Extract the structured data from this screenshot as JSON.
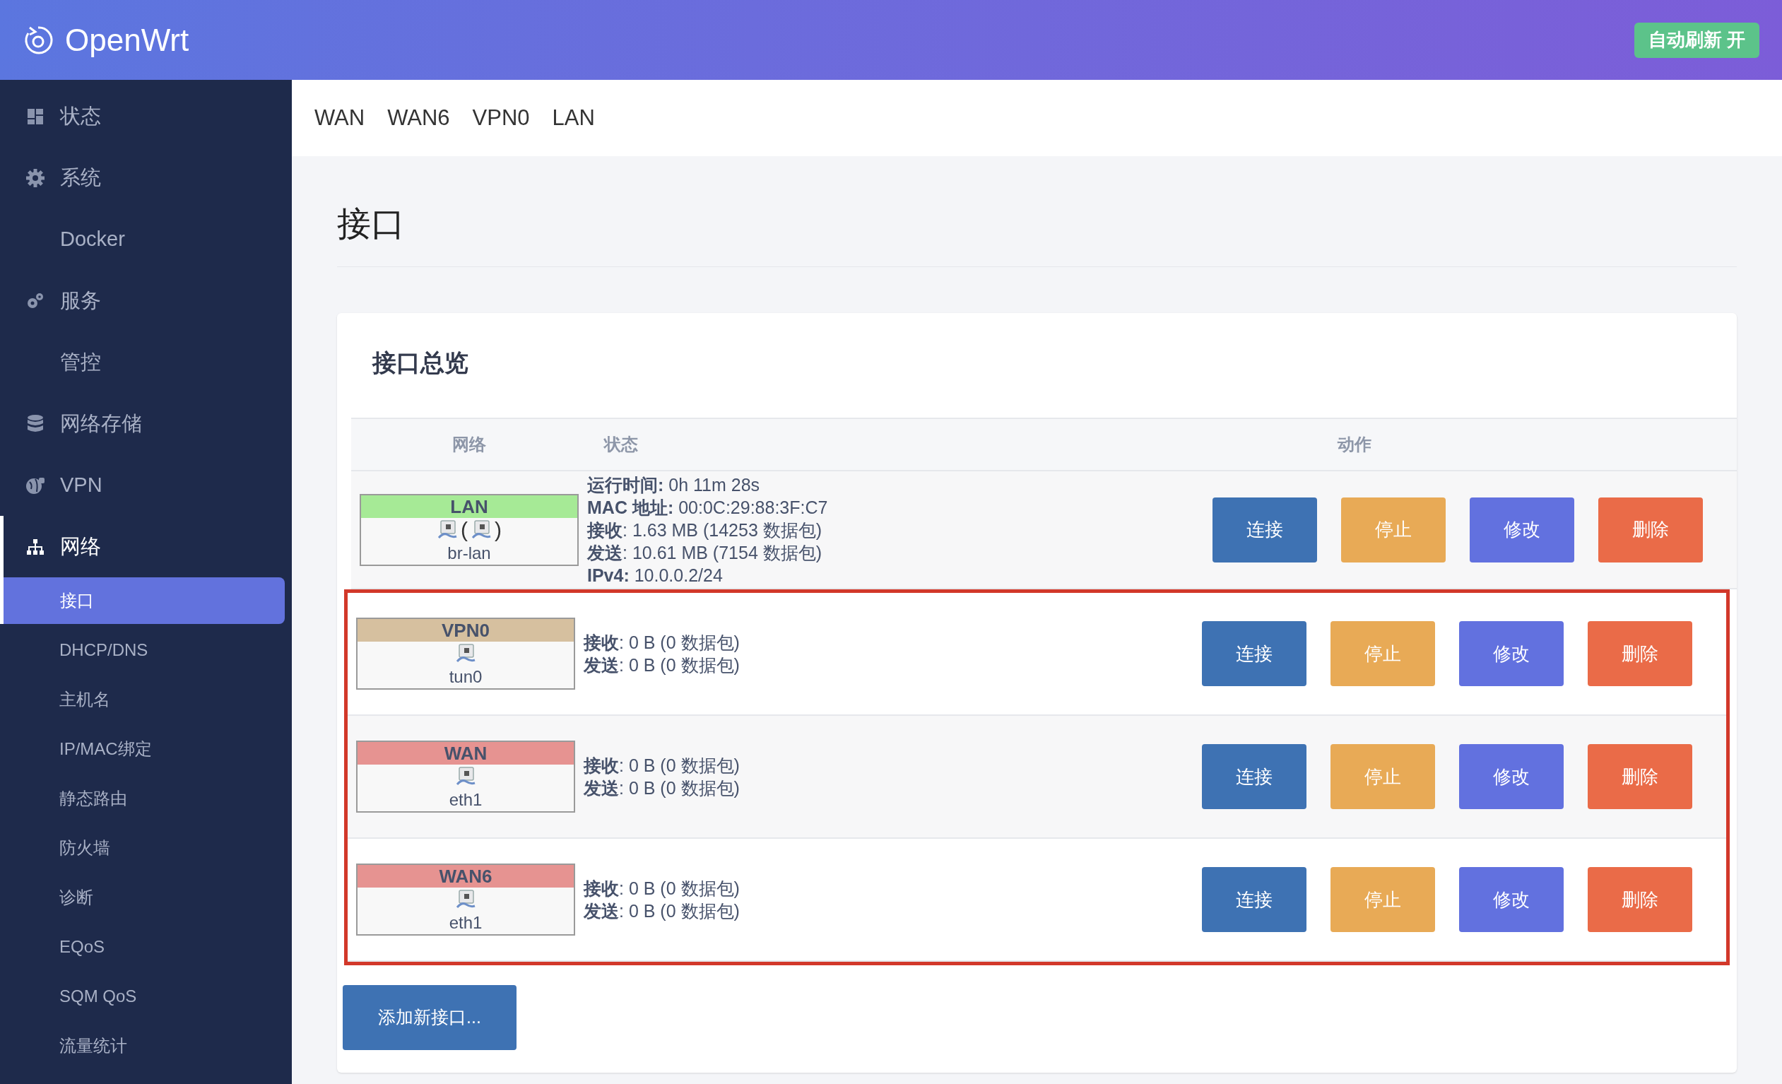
{
  "header": {
    "brand": "OpenWrt",
    "auto_refresh": {
      "label": "自动刷新 开",
      "on": true
    }
  },
  "sidebar": {
    "items": [
      {
        "label": "状态",
        "expanded": false
      },
      {
        "label": "系统",
        "expanded": false
      },
      {
        "label": "Docker",
        "expanded": false
      },
      {
        "label": "服务",
        "expanded": false
      },
      {
        "label": "管控",
        "expanded": false
      },
      {
        "label": "网络存储",
        "expanded": false
      },
      {
        "label": "VPN",
        "expanded": false
      },
      {
        "label": "网络",
        "expanded": true,
        "children": [
          {
            "label": "接口",
            "selected": true
          },
          {
            "label": "DHCP/DNS",
            "selected": false
          },
          {
            "label": "主机名",
            "selected": false
          },
          {
            "label": "IP/MAC绑定",
            "selected": false
          },
          {
            "label": "静态路由",
            "selected": false
          },
          {
            "label": "防火墙",
            "selected": false
          },
          {
            "label": "诊断",
            "selected": false
          },
          {
            "label": "EQoS",
            "selected": false
          },
          {
            "label": "SQM QoS",
            "selected": false
          },
          {
            "label": "流量统计",
            "selected": false
          }
        ]
      }
    ]
  },
  "tabs": [
    "WAN",
    "WAN6",
    "VPN0",
    "LAN"
  ],
  "page_title": "接口",
  "card": {
    "title": "接口总览",
    "table": {
      "columns": [
        "网络",
        "状态",
        "动作"
      ],
      "rows": [
        {
          "name": "LAN",
          "color": "#a6ea96",
          "kind": "bridge",
          "bracket_open": "(",
          "bracket_close": ")",
          "device": "br-lan",
          "highlighted": false,
          "status": [
            "**运行时间:** 0h 11m 28s",
            "**MAC 地址:** 00:0C:29:88:3F:C7",
            "**接收**: 1.63 MB (14253 数据包)",
            "**发送**: 10.61 MB (7154 数据包)",
            "**IPv4:** 10.0.0.2/24"
          ],
          "actions": [
            {
              "label": "连接",
              "kind": "connect"
            },
            {
              "label": "停止",
              "kind": "stop"
            },
            {
              "label": "修改",
              "kind": "edit"
            },
            {
              "label": "删除",
              "kind": "delete"
            }
          ]
        },
        {
          "name": "VPN0",
          "color": "#d6c09f",
          "kind": "single",
          "device": "tun0",
          "highlighted": true,
          "status": [
            "**接收**: 0 B (0 数据包)",
            "**发送**: 0 B (0 数据包)"
          ],
          "actions": [
            {
              "label": "连接",
              "kind": "connect"
            },
            {
              "label": "停止",
              "kind": "stop"
            },
            {
              "label": "修改",
              "kind": "edit"
            },
            {
              "label": "删除",
              "kind": "delete"
            }
          ]
        },
        {
          "name": "WAN",
          "color": "#e69391",
          "kind": "single",
          "device": "eth1",
          "highlighted": true,
          "status": [
            "**接收**: 0 B (0 数据包)",
            "**发送**: 0 B (0 数据包)"
          ],
          "actions": [
            {
              "label": "连接",
              "kind": "connect"
            },
            {
              "label": "停止",
              "kind": "stop"
            },
            {
              "label": "修改",
              "kind": "edit"
            },
            {
              "label": "删除",
              "kind": "delete"
            }
          ]
        },
        {
          "name": "WAN6",
          "color": "#e69391",
          "kind": "single",
          "device": "eth1",
          "highlighted": true,
          "status": [
            "**接收**: 0 B (0 数据包)",
            "**发送**: 0 B (0 数据包)"
          ],
          "actions": [
            {
              "label": "连接",
              "kind": "connect"
            },
            {
              "label": "停止",
              "kind": "stop"
            },
            {
              "label": "修改",
              "kind": "edit"
            },
            {
              "label": "删除",
              "kind": "delete"
            }
          ]
        }
      ]
    },
    "add_button": "添加新接口..."
  }
}
